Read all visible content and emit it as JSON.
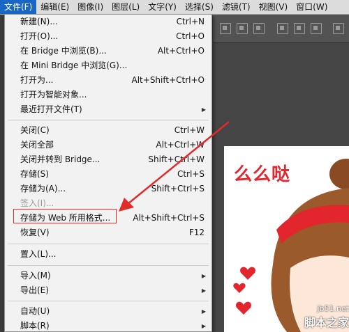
{
  "menubar": {
    "items": [
      "文件(F)",
      "编辑(E)",
      "图像(I)",
      "图层(L)",
      "文字(Y)",
      "选择(S)",
      "滤镜(T)",
      "视图(V)",
      "窗口(W)"
    ]
  },
  "file_menu": {
    "items": [
      {
        "label": "新建(N)...",
        "shortcut": "Ctrl+N"
      },
      {
        "label": "打开(O)...",
        "shortcut": "Ctrl+O"
      },
      {
        "label": "在 Bridge 中浏览(B)...",
        "shortcut": "Alt+Ctrl+O"
      },
      {
        "label": "在 Mini Bridge 中浏览(G)...",
        "shortcut": ""
      },
      {
        "label": "打开为...",
        "shortcut": "Alt+Shift+Ctrl+O"
      },
      {
        "label": "打开为智能对象...",
        "shortcut": ""
      },
      {
        "label": "最近打开文件(T)",
        "shortcut": ""
      },
      {
        "label": "关闭(C)",
        "shortcut": "Ctrl+W"
      },
      {
        "label": "关闭全部",
        "shortcut": "Alt+Ctrl+W"
      },
      {
        "label": "关闭并转到 Bridge...",
        "shortcut": "Shift+Ctrl+W"
      },
      {
        "label": "存储(S)",
        "shortcut": "Ctrl+S"
      },
      {
        "label": "存储为(A)...",
        "shortcut": "Shift+Ctrl+S"
      },
      {
        "label": "签入(I)...",
        "shortcut": ""
      },
      {
        "label": "存储为 Web 所用格式...",
        "shortcut": "Alt+Shift+Ctrl+S"
      },
      {
        "label": "恢复(V)",
        "shortcut": "F12"
      },
      {
        "label": "置入(L)...",
        "shortcut": ""
      },
      {
        "label": "导入(M)",
        "shortcut": ""
      },
      {
        "label": "导出(E)",
        "shortcut": ""
      },
      {
        "label": "自动(U)",
        "shortcut": ""
      },
      {
        "label": "脚本(R)",
        "shortcut": ""
      }
    ]
  },
  "document": {
    "caption": "么么哒"
  },
  "watermark": {
    "site": "jb51.net",
    "name": "脚本之家"
  },
  "colors": {
    "menu_active": "#1a66c4",
    "annotation_red": "#e12a2a"
  }
}
